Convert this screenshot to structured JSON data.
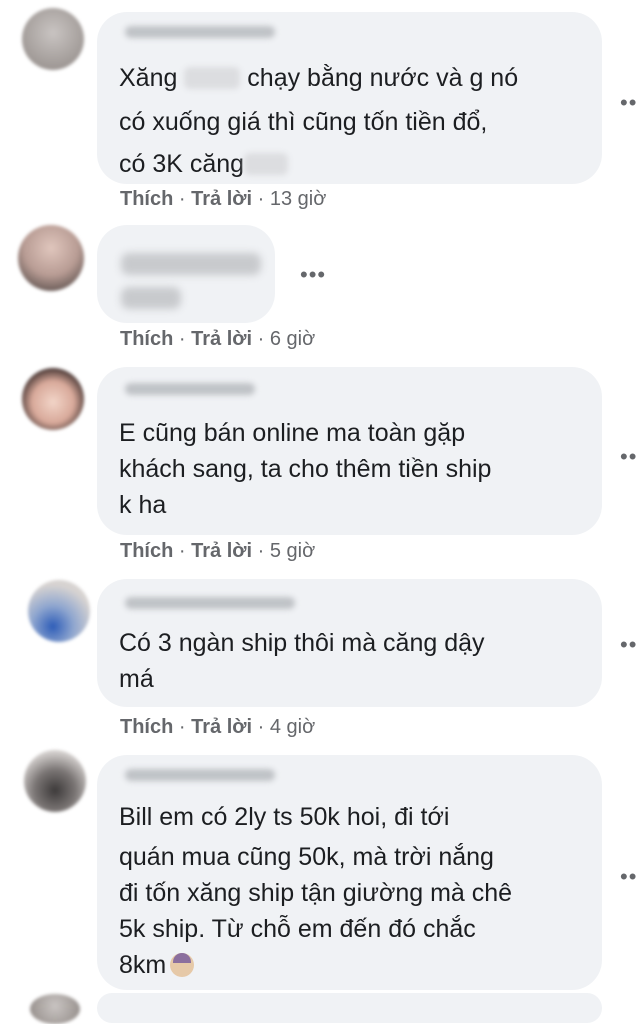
{
  "actions": {
    "like": "Thích",
    "reply": "Trả lời",
    "sep": "·"
  },
  "comments": [
    {
      "lines": [
        "Xăng",
        "chạy bằng nước và g nó",
        "có xuống giá thì cũng tốn tiền đổ,",
        "có 3K căng"
      ],
      "time": "13 giờ"
    },
    {
      "lines": [],
      "time": "6 giờ"
    },
    {
      "lines": [
        "E cũng bán online ma toàn gặp",
        "khách sang, ta cho thêm tiền ship",
        "k ha"
      ],
      "time": "5 giờ"
    },
    {
      "lines": [
        "Có 3 ngàn ship thôi mà căng dậy",
        "má"
      ],
      "time": "4 giờ"
    },
    {
      "lines": [
        "Bill em có 2ly ts 50k hoi, đi tới",
        "quán mua cũng 50k, mà trời nắng",
        "đi tốn xăng ship tận giường mà chê",
        "5k ship. Từ chỗ em đến đó chắc",
        "8km"
      ],
      "time": ""
    }
  ],
  "icons": {
    "more": "more-options-icon",
    "emoji": "face-emoji-icon"
  }
}
